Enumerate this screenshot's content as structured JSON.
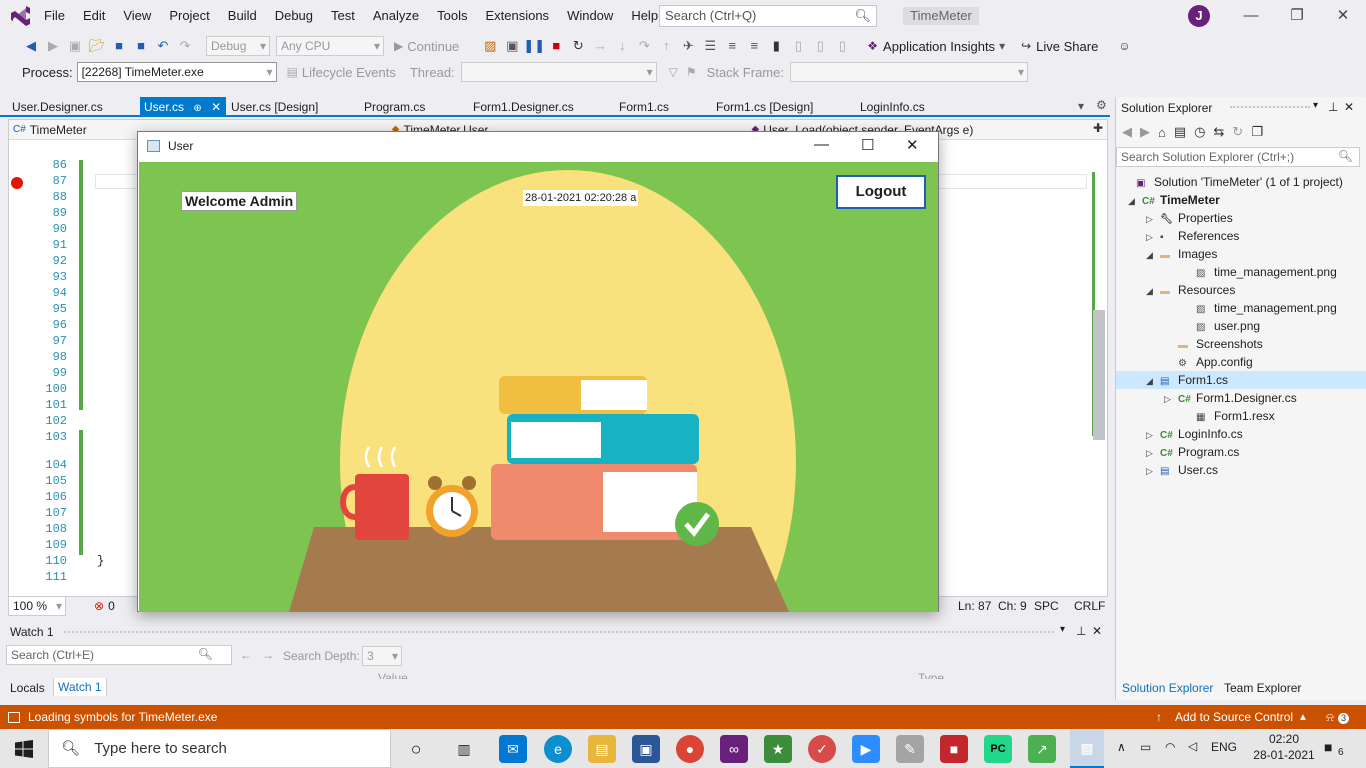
{
  "menu": [
    "File",
    "Edit",
    "View",
    "Project",
    "Build",
    "Debug",
    "Test",
    "Analyze",
    "Tools",
    "Extensions",
    "Window",
    "Help"
  ],
  "search": {
    "placeholder": "Search (Ctrl+Q)"
  },
  "solution_name": "TimeMeter",
  "user_initial": "J",
  "toolbar": {
    "config": "Debug",
    "platform": "Any CPU",
    "continue": "Continue",
    "app_insights": "Application Insights",
    "live_share": "Live Share"
  },
  "process_bar": {
    "process_label": "Process:",
    "process_value": "[22268] TimeMeter.exe",
    "lifecycle": "Lifecycle Events",
    "thread_label": "Thread:",
    "stack_label": "Stack Frame:"
  },
  "tabs": [
    {
      "label": "User.Designer.cs"
    },
    {
      "label": "User.cs"
    },
    {
      "label": "User.cs [Design]"
    },
    {
      "label": "Program.cs"
    },
    {
      "label": "Form1.Designer.cs"
    },
    {
      "label": "Form1.cs"
    },
    {
      "label": "Form1.cs [Design]"
    },
    {
      "label": "LoginInfo.cs"
    }
  ],
  "editor": {
    "nav_project": "TimeMeter",
    "nav_class": "TimeMeter.User",
    "nav_member": "User_Load(object sender, EventArgs e)",
    "line_numbers": [
      "86",
      "87",
      "88",
      "89",
      "90",
      "91",
      "92",
      "93",
      "94",
      "95",
      "96",
      "97",
      "98",
      "99",
      "100",
      "101",
      "102",
      "103",
      "104",
      "105",
      "106",
      "107",
      "108",
      "109",
      "110",
      "111"
    ],
    "closing_brace": "}"
  },
  "editor_status": {
    "zoom": "100 %",
    "errors": "0",
    "ln": "Ln: 87",
    "ch": "Ch: 9",
    "spc": "SPC",
    "crlf": "CRLF"
  },
  "watch": {
    "title": "Watch 1",
    "search_placeholder": "Search (Ctrl+E)",
    "depth_label": "Search Depth:",
    "depth_value": "3",
    "col_value": "Value",
    "col_type": "Type",
    "tab_locals": "Locals",
    "tab_watch": "Watch 1"
  },
  "solution_explorer": {
    "title": "Solution Explorer",
    "search_placeholder": "Search Solution Explorer (Ctrl+;)",
    "items": [
      {
        "label": "Solution 'TimeMeter' (1 of 1 project)",
        "icon": "solution-icon"
      },
      {
        "label": "TimeMeter",
        "icon": "csproj-icon"
      },
      {
        "label": "Properties",
        "icon": "wrench-icon"
      },
      {
        "label": "References",
        "icon": "references-icon"
      },
      {
        "label": "Images",
        "icon": "folder-icon"
      },
      {
        "label": "time_management.png",
        "icon": "image-file-icon"
      },
      {
        "label": "Resources",
        "icon": "folder-icon"
      },
      {
        "label": "time_management.png",
        "icon": "image-file-icon"
      },
      {
        "label": "user.png",
        "icon": "image-file-icon"
      },
      {
        "label": "Screenshots",
        "icon": "folder-icon"
      },
      {
        "label": "App.config",
        "icon": "config-file-icon"
      },
      {
        "label": "Form1.cs",
        "icon": "form-icon"
      },
      {
        "label": "Form1.Designer.cs",
        "icon": "cs-file-icon"
      },
      {
        "label": "Form1.resx",
        "icon": "resx-file-icon"
      },
      {
        "label": "LoginInfo.cs",
        "icon": "cs-file-icon"
      },
      {
        "label": "Program.cs",
        "icon": "cs-file-icon"
      },
      {
        "label": "User.cs",
        "icon": "form-icon"
      }
    ],
    "tab_solution": "Solution Explorer",
    "tab_team": "Team Explorer"
  },
  "statusbar": {
    "message": "Loading symbols for TimeMeter.exe",
    "source_control": "Add to Source Control",
    "notifications": "3"
  },
  "form": {
    "title": "User",
    "welcome": "Welcome  Admin",
    "datetime": "28-01-2021 02:20:28 a",
    "logout": "Logout"
  },
  "taskbar": {
    "search_placeholder": "Type here to search",
    "lang": "ENG",
    "time": "02:20",
    "date": "28-01-2021",
    "notif_count": "6"
  },
  "colors": {
    "accent": "#007acc",
    "statusbar": "#ca5100",
    "form_bg": "#7ec451",
    "sun": "#f9e17d",
    "table": "#a57a4f"
  }
}
